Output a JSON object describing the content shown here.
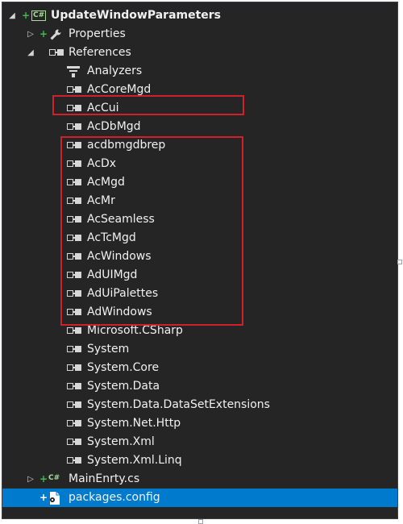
{
  "tree": {
    "project": {
      "name": "UpdateWindowParameters",
      "lang_badge": "C#"
    },
    "properties": {
      "label": "Properties"
    },
    "references": {
      "label": "References"
    },
    "items": [
      {
        "label": "Analyzers",
        "icon": "analyzer-icon"
      },
      {
        "label": "AcCoreMgd",
        "icon": "reference-icon"
      },
      {
        "label": "AcCui",
        "icon": "reference-icon"
      },
      {
        "label": "AcDbMgd",
        "icon": "reference-icon"
      },
      {
        "label": "acdbmgdbrep",
        "icon": "reference-icon"
      },
      {
        "label": "AcDx",
        "icon": "reference-icon"
      },
      {
        "label": "AcMgd",
        "icon": "reference-icon"
      },
      {
        "label": "AcMr",
        "icon": "reference-icon"
      },
      {
        "label": "AcSeamless",
        "icon": "reference-icon"
      },
      {
        "label": "AcTcMgd",
        "icon": "reference-icon"
      },
      {
        "label": "AcWindows",
        "icon": "reference-icon"
      },
      {
        "label": "AdUIMgd",
        "icon": "reference-icon"
      },
      {
        "label": "AdUiPalettes",
        "icon": "reference-icon"
      },
      {
        "label": "AdWindows",
        "icon": "reference-icon"
      },
      {
        "label": "Microsoft.CSharp",
        "icon": "reference-icon"
      },
      {
        "label": "System",
        "icon": "reference-icon"
      },
      {
        "label": "System.Core",
        "icon": "reference-icon"
      },
      {
        "label": "System.Data",
        "icon": "reference-icon"
      },
      {
        "label": "System.Data.DataSetExtensions",
        "icon": "reference-icon"
      },
      {
        "label": "System.Net.Http",
        "icon": "reference-icon"
      },
      {
        "label": "System.Xml",
        "icon": "reference-icon"
      },
      {
        "label": "System.Xml.Linq",
        "icon": "reference-icon"
      }
    ],
    "main_file": {
      "label": "MainEnrty.cs",
      "lang_badge": "C#"
    },
    "packages": {
      "label": "packages.config",
      "selected": true
    }
  },
  "colors": {
    "background": "#252526",
    "selection": "#007acc",
    "highlight_border": "#d1202a",
    "add_marker": "#3fb950"
  }
}
